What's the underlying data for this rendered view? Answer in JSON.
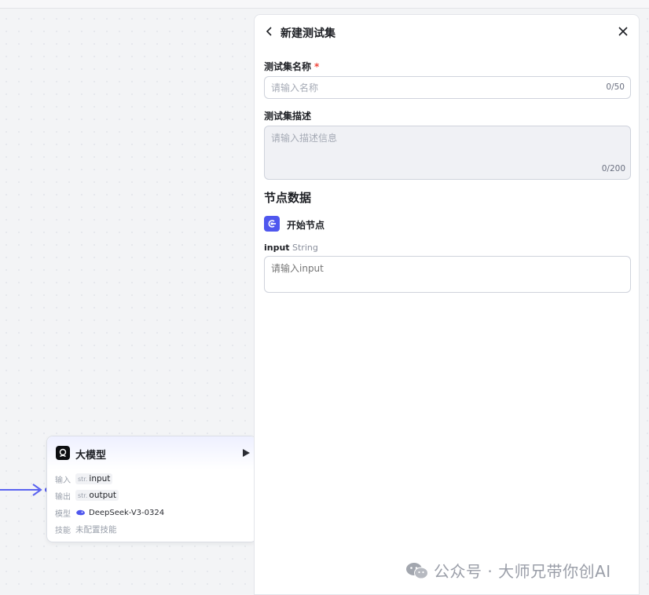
{
  "canvas": {
    "node": {
      "title": "大模型",
      "input_label": "输入",
      "input_type": "str.",
      "input_var": "input",
      "output_label": "输出",
      "output_type": "str.",
      "output_var": "output",
      "model_label": "模型",
      "model_name": "DeepSeek-V3-0324",
      "model_icon": "whale-icon",
      "skill_label": "技能",
      "skill_value": "未配置技能"
    }
  },
  "panel": {
    "title": "新建测试集",
    "name_label": "测试集名称",
    "required_mark": "*",
    "name_placeholder": "请输入名称",
    "name_counter": "0/50",
    "desc_label": "测试集描述",
    "desc_placeholder": "请输入描述信息",
    "desc_counter": "0/200",
    "section_title": "节点数据",
    "start_node_label": "开始节点",
    "param_name": "input",
    "param_type": "String",
    "param_placeholder": "请输入input"
  },
  "watermark": {
    "text": "公众号 · 大师兄带你创AI"
  },
  "colors": {
    "accent": "#4f57ee",
    "required": "#f0453a",
    "edge": "#5b63f0"
  }
}
